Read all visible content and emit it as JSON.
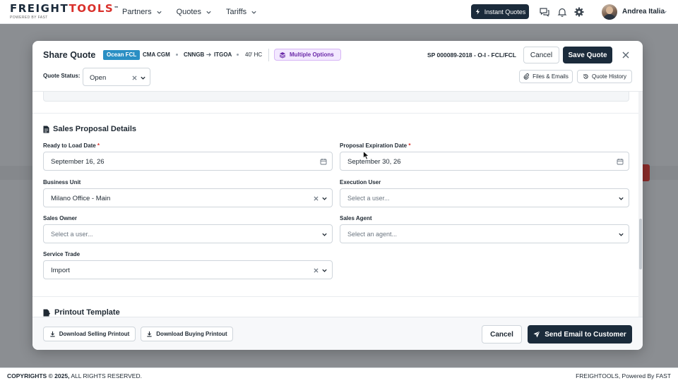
{
  "brand": {
    "name_dark": "FREIGHT",
    "name_red": "TOOLS",
    "trademark": "™",
    "tagline": "POWERED BY FAST"
  },
  "nav": {
    "items": [
      {
        "label": "Partners"
      },
      {
        "label": "Quotes"
      },
      {
        "label": "Tariffs"
      }
    ]
  },
  "header": {
    "instant_quotes_label": "Instant Quotes",
    "user_name": "Andrea Italia"
  },
  "modal": {
    "title": "Share Quote",
    "mode_badge": "Ocean FCL",
    "carrier": "CMA CGM",
    "origin": "CNNGB",
    "destination": "ITGOA",
    "equipment": "40' HC",
    "multiple_options_label": "Multiple Options",
    "quote_ref": "SP 000089-2018 - O-I - FCL/FCL",
    "cancel_label": "Cancel",
    "save_label": "Save Quote",
    "quote_status_label": "Quote Status:",
    "quote_status_value": "Open",
    "files_emails_label": "Files & Emails",
    "quote_history_label": "Quote History",
    "sales_section": {
      "title": "Sales Proposal Details",
      "ready_to_load": {
        "label": "Ready to Load Date",
        "required": "*",
        "value": "September 16, 26"
      },
      "proposal_expiration": {
        "label": "Proposal Expiration Date",
        "required": "*",
        "value": "September 30, 26"
      },
      "business_unit": {
        "label": "Business Unit",
        "value": "Milano Office - Main"
      },
      "execution_user": {
        "label": "Execution User",
        "placeholder": "Select a user..."
      },
      "sales_owner": {
        "label": "Sales Owner",
        "placeholder": "Select a user..."
      },
      "sales_agent": {
        "label": "Sales Agent",
        "placeholder": "Select an agent..."
      },
      "service_trade": {
        "label": "Service Trade",
        "value": "Import"
      }
    },
    "printout_section": {
      "title": "Printout Template"
    },
    "footer": {
      "download_selling_label": "Download Selling Printout",
      "download_buying_label": "Download Buying Printout",
      "cancel_label": "Cancel",
      "send_email_label": "Send Email to Customer"
    }
  },
  "page_footer": {
    "copyright_bold": "COPYRIGHTS © 2025,",
    "copyright_rest": " ALL RIGHTS RESERVED.",
    "powered": "FREIGHTOOLS, Powered By FAST"
  },
  "colors": {
    "navy": "#1b2b3b",
    "brand_red": "#d9302b",
    "ocean_badge": "#2a8fc4",
    "multi_option_purple": "#6b2aa8"
  },
  "icons": [
    "bolt-icon",
    "chat-icon",
    "bell-icon",
    "gear-icon",
    "chevron-down-icon",
    "close-icon",
    "calendar-icon",
    "clear-icon",
    "paperclip-icon",
    "history-icon",
    "layers-icon",
    "document-icon",
    "download-icon",
    "send-icon",
    "arrow-right-icon"
  ]
}
